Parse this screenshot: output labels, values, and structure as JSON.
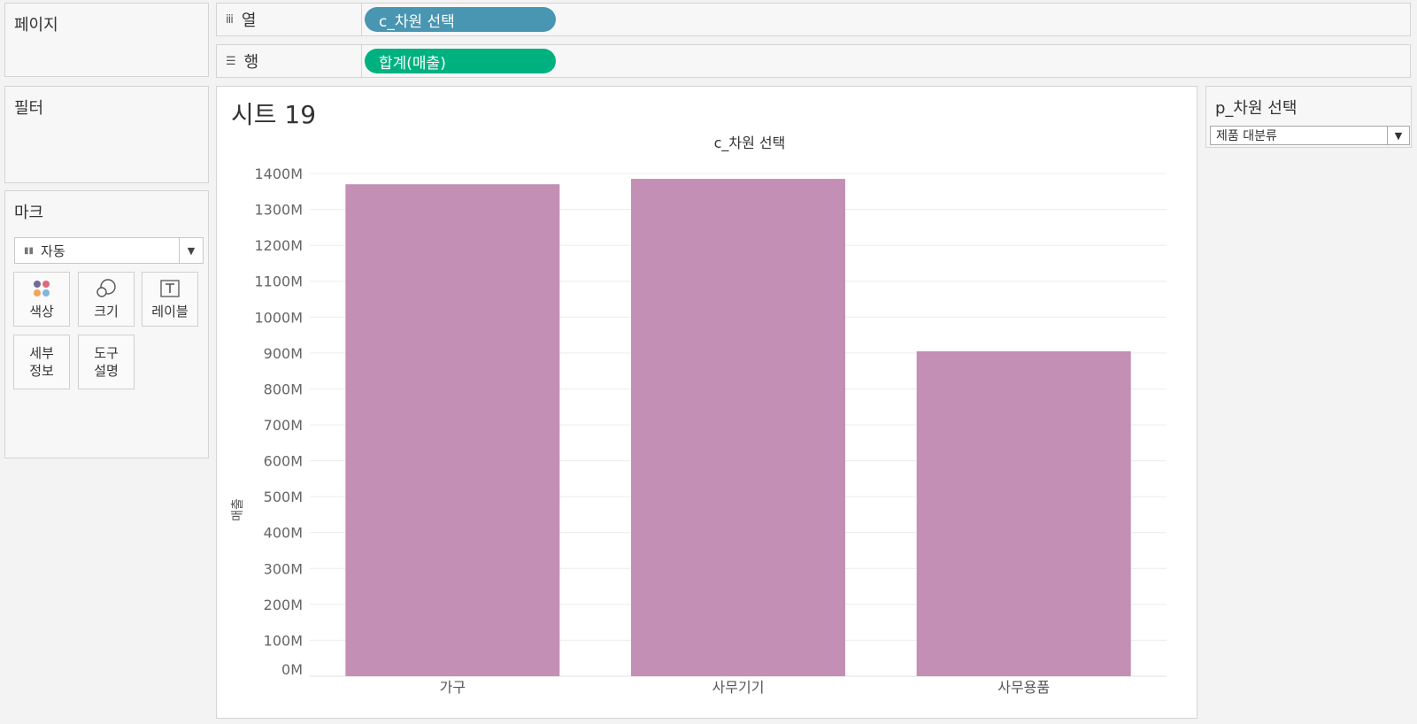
{
  "cards": {
    "pages_label": "페이지",
    "filters_label": "필터"
  },
  "columns_shelf": {
    "label": "열",
    "icon": "columns-icon",
    "pill": "c_차원 선택",
    "pill_color": "#4996b2"
  },
  "rows_shelf": {
    "label": "행",
    "icon": "rows-icon",
    "pill": "합계(매출)",
    "pill_color": "#00b180"
  },
  "marks": {
    "title": "마크",
    "type": "자동",
    "buttons": [
      {
        "label": "색상",
        "icon": "color-icon"
      },
      {
        "label": "크기",
        "icon": "size-icon"
      },
      {
        "label": "레이블",
        "icon": "label-icon"
      },
      {
        "label": "세부\n정보",
        "icon": "detail-icon"
      },
      {
        "label": "도구\n설명",
        "icon": "tooltip-icon"
      }
    ]
  },
  "sheet": {
    "title": "시트 19"
  },
  "parameter": {
    "title": "p_차원 선택",
    "value": "제품 대분류"
  },
  "chart_data": {
    "type": "bar",
    "title": "c_차원 선택",
    "xlabel": "",
    "ylabel": "매출",
    "categories": [
      "가구",
      "사무기기",
      "사무용품"
    ],
    "values": [
      1370,
      1385,
      905
    ],
    "unit": "M",
    "ylim": [
      0,
      1400
    ],
    "yticks": [
      0,
      100,
      200,
      300,
      400,
      500,
      600,
      700,
      800,
      900,
      1000,
      1100,
      1200,
      1300,
      1400
    ],
    "ytick_labels": [
      "0M",
      "100M",
      "200M",
      "300M",
      "400M",
      "500M",
      "600M",
      "700M",
      "800M",
      "900M",
      "1000M",
      "1100M",
      "1200M",
      "1300M",
      "1400M"
    ],
    "bar_color": "#c38fb4",
    "grid": true
  }
}
